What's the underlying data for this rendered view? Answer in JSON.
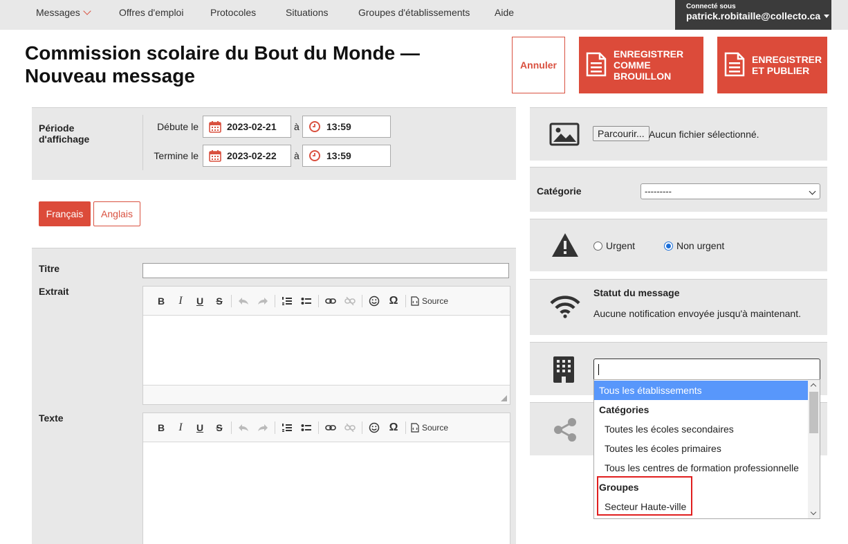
{
  "nav": {
    "items": [
      "Messages",
      "Offres d'emploi",
      "Protocoles",
      "Situations",
      "Groupes d'établissements",
      "Aide"
    ],
    "user_caption": "Connecté sous",
    "user_email": "patrick.robitaille@collecto.ca"
  },
  "header": {
    "title_line1": "Commission scolaire du Bout du Monde —",
    "title_line2": "Nouveau message",
    "cancel_label": "Annuler",
    "draft_label_1": "ENREGISTRER",
    "draft_label_2": "COMME",
    "draft_label_3": "BROUILLON",
    "publish_label_1": "ENREGISTRER",
    "publish_label_2": "ET PUBLIER"
  },
  "period": {
    "label_1": "Période",
    "label_2": "d'affichage",
    "start_label": "Débute le",
    "start_date": "2023-02-21",
    "start_time": "13:59",
    "end_label": "Termine le",
    "end_date": "2023-02-22",
    "end_time": "13:59",
    "at": "à"
  },
  "lang": {
    "fr": "Français",
    "en": "Anglais"
  },
  "form": {
    "title_label": "Titre",
    "title_value": "",
    "excerpt_label": "Extrait",
    "text_label": "Texte",
    "source_label": "Source"
  },
  "image": {
    "browse": "Parcourir...",
    "no_file": "Aucun fichier sélectionné."
  },
  "category": {
    "label": "Catégorie",
    "selected": "---------"
  },
  "urgency": {
    "urgent": "Urgent",
    "not_urgent": "Non urgent",
    "selected": "Non urgent"
  },
  "status": {
    "title": "Statut du message",
    "text": "Aucune notification envoyée jusqu'à maintenant."
  },
  "establishments": {
    "options": [
      {
        "label": "Tous les établissements",
        "kind": "option",
        "selected": true
      },
      {
        "label": "Catégories",
        "kind": "group"
      },
      {
        "label": "Toutes les écoles secondaires",
        "kind": "child"
      },
      {
        "label": "Toutes les écoles primaires",
        "kind": "child"
      },
      {
        "label": "Tous les centres de formation professionnelle",
        "kind": "child"
      },
      {
        "label": "Groupes",
        "kind": "group"
      },
      {
        "label": "Secteur Haute-ville",
        "kind": "child"
      }
    ]
  },
  "colors": {
    "accent": "#dc4b3a",
    "panel": "#e8e8e8",
    "userbar": "#3b3b3b",
    "highlight": "#5897fb"
  }
}
